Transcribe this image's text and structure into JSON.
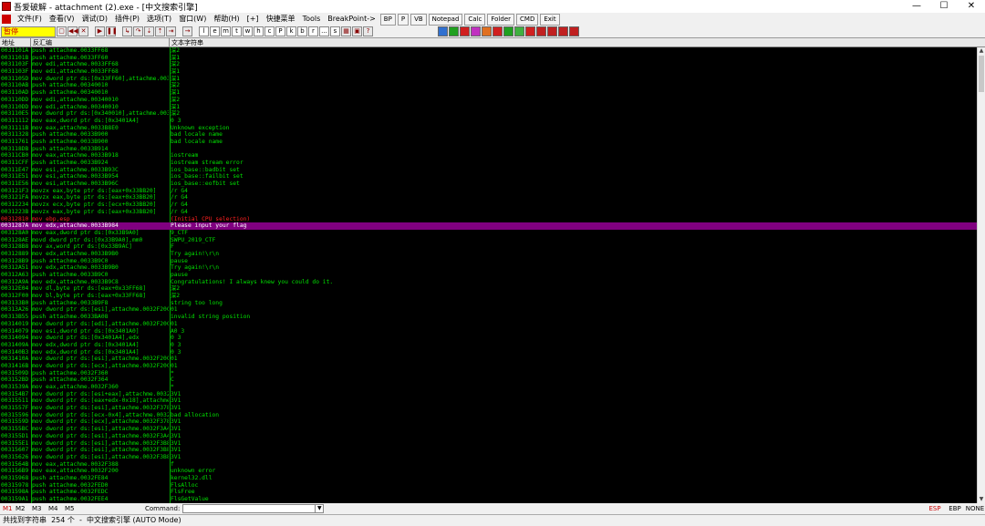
{
  "window": {
    "title": "吾爱破解 - attachment (2).exe - [中文搜索引擎]",
    "controls": [
      "—",
      "☐",
      "✕"
    ]
  },
  "menu": {
    "items": [
      "文件(F)",
      "查看(V)",
      "调试(D)",
      "插件(P)",
      "选项(T)",
      "窗口(W)",
      "帮助(H)",
      "[+]",
      "快捷菜单",
      "Tools",
      "BreakPoint->"
    ],
    "buttons": [
      "BP",
      "P",
      "VB",
      "Notepad",
      "Calc",
      "Folder",
      "CMD",
      "Exit"
    ]
  },
  "toolbar": {
    "status": "暂停",
    "letters": [
      "l",
      "e",
      "m",
      "t",
      "w",
      "h",
      "c",
      "P",
      "k",
      "b",
      "r",
      "...",
      "s"
    ]
  },
  "columns": {
    "address": "地址",
    "disasm": "反汇编",
    "string": "文本字符串"
  },
  "rows": [
    {
      "a": "0031101A",
      "d": "push attachme.0033FF68",
      "s": "深2"
    },
    {
      "a": "0031101B",
      "d": "push attachme.0033FF60",
      "s": "深1"
    },
    {
      "a": "0031103F",
      "d": "mov edi,attachme.0033FF68",
      "s": "深2"
    },
    {
      "a": "0031103F",
      "d": "mov edi,attachme.0033FF68",
      "s": "深1"
    },
    {
      "a": "0031105D",
      "d": "mov dword ptr ds:[0x33FF60],attachme.0034",
      "s": "深1"
    },
    {
      "a": "003110AB",
      "d": "push attachme.00340010",
      "s": "深2"
    },
    {
      "a": "003110AD",
      "d": "push attachme.00340010",
      "s": "深1"
    },
    {
      "a": "003110DD",
      "d": "mov edi,attachme.00340010",
      "s": "深2"
    },
    {
      "a": "003110DD",
      "d": "mov edi,attachme.00340010",
      "s": "深1"
    },
    {
      "a": "003110E5",
      "d": "mov dword ptr ds:[0x340010],attachme.0034",
      "s": "深2"
    },
    {
      "a": "00311112",
      "d": "mov eax,dword ptr ds:[0x3401A4]",
      "s": "0 3"
    },
    {
      "a": "0031111B",
      "d": "mov eax,attachme.0033B8E0",
      "s": "Unknown exception"
    },
    {
      "a": "00311328",
      "d": "push attachme.0033B900",
      "s": "bad locale name"
    },
    {
      "a": "00311761",
      "d": "push attachme.0033B900",
      "s": "bad locale name"
    },
    {
      "a": "003118DB",
      "d": "push attachme.0033B914",
      "s": ""
    },
    {
      "a": "00311CB0",
      "d": "mov eax,attachme.0033B918",
      "s": "iostream"
    },
    {
      "a": "00311CFF",
      "d": "push attachme.0033B924",
      "s": "iostream stream error"
    },
    {
      "a": "00311E47",
      "d": "mov esi,attachme.0033B93C",
      "s": "ios_base::badbit set"
    },
    {
      "a": "00311E51",
      "d": "mov esi,attachme.0033B954",
      "s": "ios_base::failbit set"
    },
    {
      "a": "00311E56",
      "d": "mov esi,attachme.0033B96C",
      "s": "ios_base::eofbit set"
    },
    {
      "a": "003121F3",
      "d": "movzx eax,byte ptr ds:[eax+0x33BB20]",
      "s": "/r G4"
    },
    {
      "a": "003121FA",
      "d": "movzx eax,byte ptr ds:[eax+0x33BB20]",
      "s": "/r G4"
    },
    {
      "a": "00312234",
      "d": "movzx ecx,byte ptr ds:[ecx+0x33BB20]",
      "s": "/r G4"
    },
    {
      "a": "0031223B",
      "d": "movzx eax,byte ptr ds:[eax+0x33BB20]",
      "s": "/r G4"
    },
    {
      "a": "00312810",
      "d": "mov ebp,esp",
      "s": "(Initial CPU selection)",
      "red": true
    },
    {
      "a": "0031287A",
      "d": "mov edx,attachme.0033B984",
      "s": "Please input your flag",
      "sel": true
    },
    {
      "a": "003128A0",
      "d": "mov eax,dword ptr ds:[0x33B9A0]",
      "s": "9_CTF"
    },
    {
      "a": "003128AE",
      "d": "movd dword ptr ds:[0x33B9A0],mm0",
      "s": "SWPU_2019_CTF"
    },
    {
      "a": "003128B8",
      "d": "mov ax,word ptr ds:[0x33B9AC]",
      "s": "F"
    },
    {
      "a": "00312889",
      "d": "mov edx,attachme.0033B9B0",
      "s": "Try again!\\r\\n"
    },
    {
      "a": "003128B9",
      "d": "push attachme.0033B9C0",
      "s": "pause"
    },
    {
      "a": "00312A51",
      "d": "mov edx,attachme.0033B9B0",
      "s": "Try again!\\r\\n"
    },
    {
      "a": "00312A63",
      "d": "push attachme.0033B9C0",
      "s": "pause"
    },
    {
      "a": "00312A9A",
      "d": "mov edx,attachme.0033B9C8",
      "s": "Congratulations! I always knew you could do it."
    },
    {
      "a": "00312E04",
      "d": "mov dl,byte ptr ds:[eax+0x33FF68]",
      "s": "深2"
    },
    {
      "a": "00312F00",
      "d": "mov bl,byte ptr ds:[eax+0x33FF68]",
      "s": "深2"
    },
    {
      "a": "003133B0",
      "d": "push attachme.0033B9F8",
      "s": "string too long"
    },
    {
      "a": "00313A26",
      "d": "mov dword ptr ds:[esi],attachme.0032F20C",
      "s": "01"
    },
    {
      "a": "00313B55",
      "d": "push attachme.0033BA08",
      "s": "invalid string position"
    },
    {
      "a": "00314019",
      "d": "mov dword ptr ds:[edi],attachme.0032F20C",
      "s": "01"
    },
    {
      "a": "00314079",
      "d": "mov esi,dword ptr ds:[0x3401A0]",
      "s": "A0 3"
    },
    {
      "a": "00314094",
      "d": "mov dword ptr ds:[0x3401A4],edx",
      "s": "0 3"
    },
    {
      "a": "0031409A",
      "d": "mov edx,dword ptr ds:[0x3401A4]",
      "s": "0 3"
    },
    {
      "a": "003140B3",
      "d": "mov edx,dword ptr ds:[0x3401A4]",
      "s": "0 3"
    },
    {
      "a": "0031410A",
      "d": "mov dword ptr ds:[esi],attachme.0032F20C",
      "s": "01"
    },
    {
      "a": "0031416B",
      "d": "mov dword ptr ds:[ecx],attachme.0032F20C",
      "s": "01"
    },
    {
      "a": "0031509D",
      "d": "push attachme.0032F360",
      "s": "*"
    },
    {
      "a": "003152BD",
      "d": "push attachme.0032F364",
      "s": "C"
    },
    {
      "a": "0031539A",
      "d": "mov eax,attachme.0032F360",
      "s": "*"
    },
    {
      "a": "003154B7",
      "d": "mov dword ptr ds:[esi+eax],attachme.0032",
      "s": "3V1"
    },
    {
      "a": "00315511",
      "d": "mov dword ptr ds:[eax+edx-0x18],attachme",
      "s": "3V1"
    },
    {
      "a": "0031557F",
      "d": "mov dword ptr ds:[esi],attachme.0032F378",
      "s": "3V1"
    },
    {
      "a": "00315596",
      "d": "mov dword ptr ds:[ecx-0x4],attachme.0032",
      "s": "bad allocation"
    },
    {
      "a": "0031559D",
      "d": "mov dword ptr ds:[ecx],attachme.0032F378",
      "s": "3V1"
    },
    {
      "a": "003155BC",
      "d": "mov dword ptr ds:[esi],attachme.0032F3A4",
      "s": "3V1"
    },
    {
      "a": "003155D1",
      "d": "mov dword ptr ds:[esi],attachme.0032F3A4",
      "s": "3V1"
    },
    {
      "a": "003155E1",
      "d": "mov dword ptr ds:[esi],attachme.0032F3B8",
      "s": "3V1"
    },
    {
      "a": "00315607",
      "d": "mov dword ptr ds:[esi],attachme.0032F3B8",
      "s": "3V1"
    },
    {
      "a": "00315626",
      "d": "mov dword ptr ds:[esi],attachme.0032F3B8",
      "s": "3V1"
    },
    {
      "a": "0031564B",
      "d": "mov eax,attachme.0032F388",
      "s": "f"
    },
    {
      "a": "003156B9",
      "d": "mov eax,attachme.0032F200",
      "s": "unknown error"
    },
    {
      "a": "00315968",
      "d": "push attachme.0032FE84",
      "s": "kernel32.dll"
    },
    {
      "a": "00315978",
      "d": "push attachme.0032FED0",
      "s": "FlsAlloc"
    },
    {
      "a": "0031598A",
      "d": "push attachme.0032FEDC",
      "s": "FlsFree"
    },
    {
      "a": "003159A1",
      "d": "push attachme.0032FEE4",
      "s": "FlsGetValue"
    },
    {
      "a": "003159B8",
      "d": "push attachme.0032FEF0",
      "s": "FlsSetValue"
    }
  ],
  "cmdbar": {
    "marks": [
      "M1",
      "M2",
      "M3",
      "M4",
      "M5"
    ],
    "command_label": "Command:",
    "registers": [
      "ESP",
      "EBP",
      "NONE"
    ]
  },
  "statusbar": {
    "text": "共找到字符串  254 个  -  中文搜索引擎 (AUTO Mode)"
  },
  "colors": {
    "background": "#000000",
    "text": "#00e000",
    "selected": "#800080",
    "current": "#ff2020"
  }
}
